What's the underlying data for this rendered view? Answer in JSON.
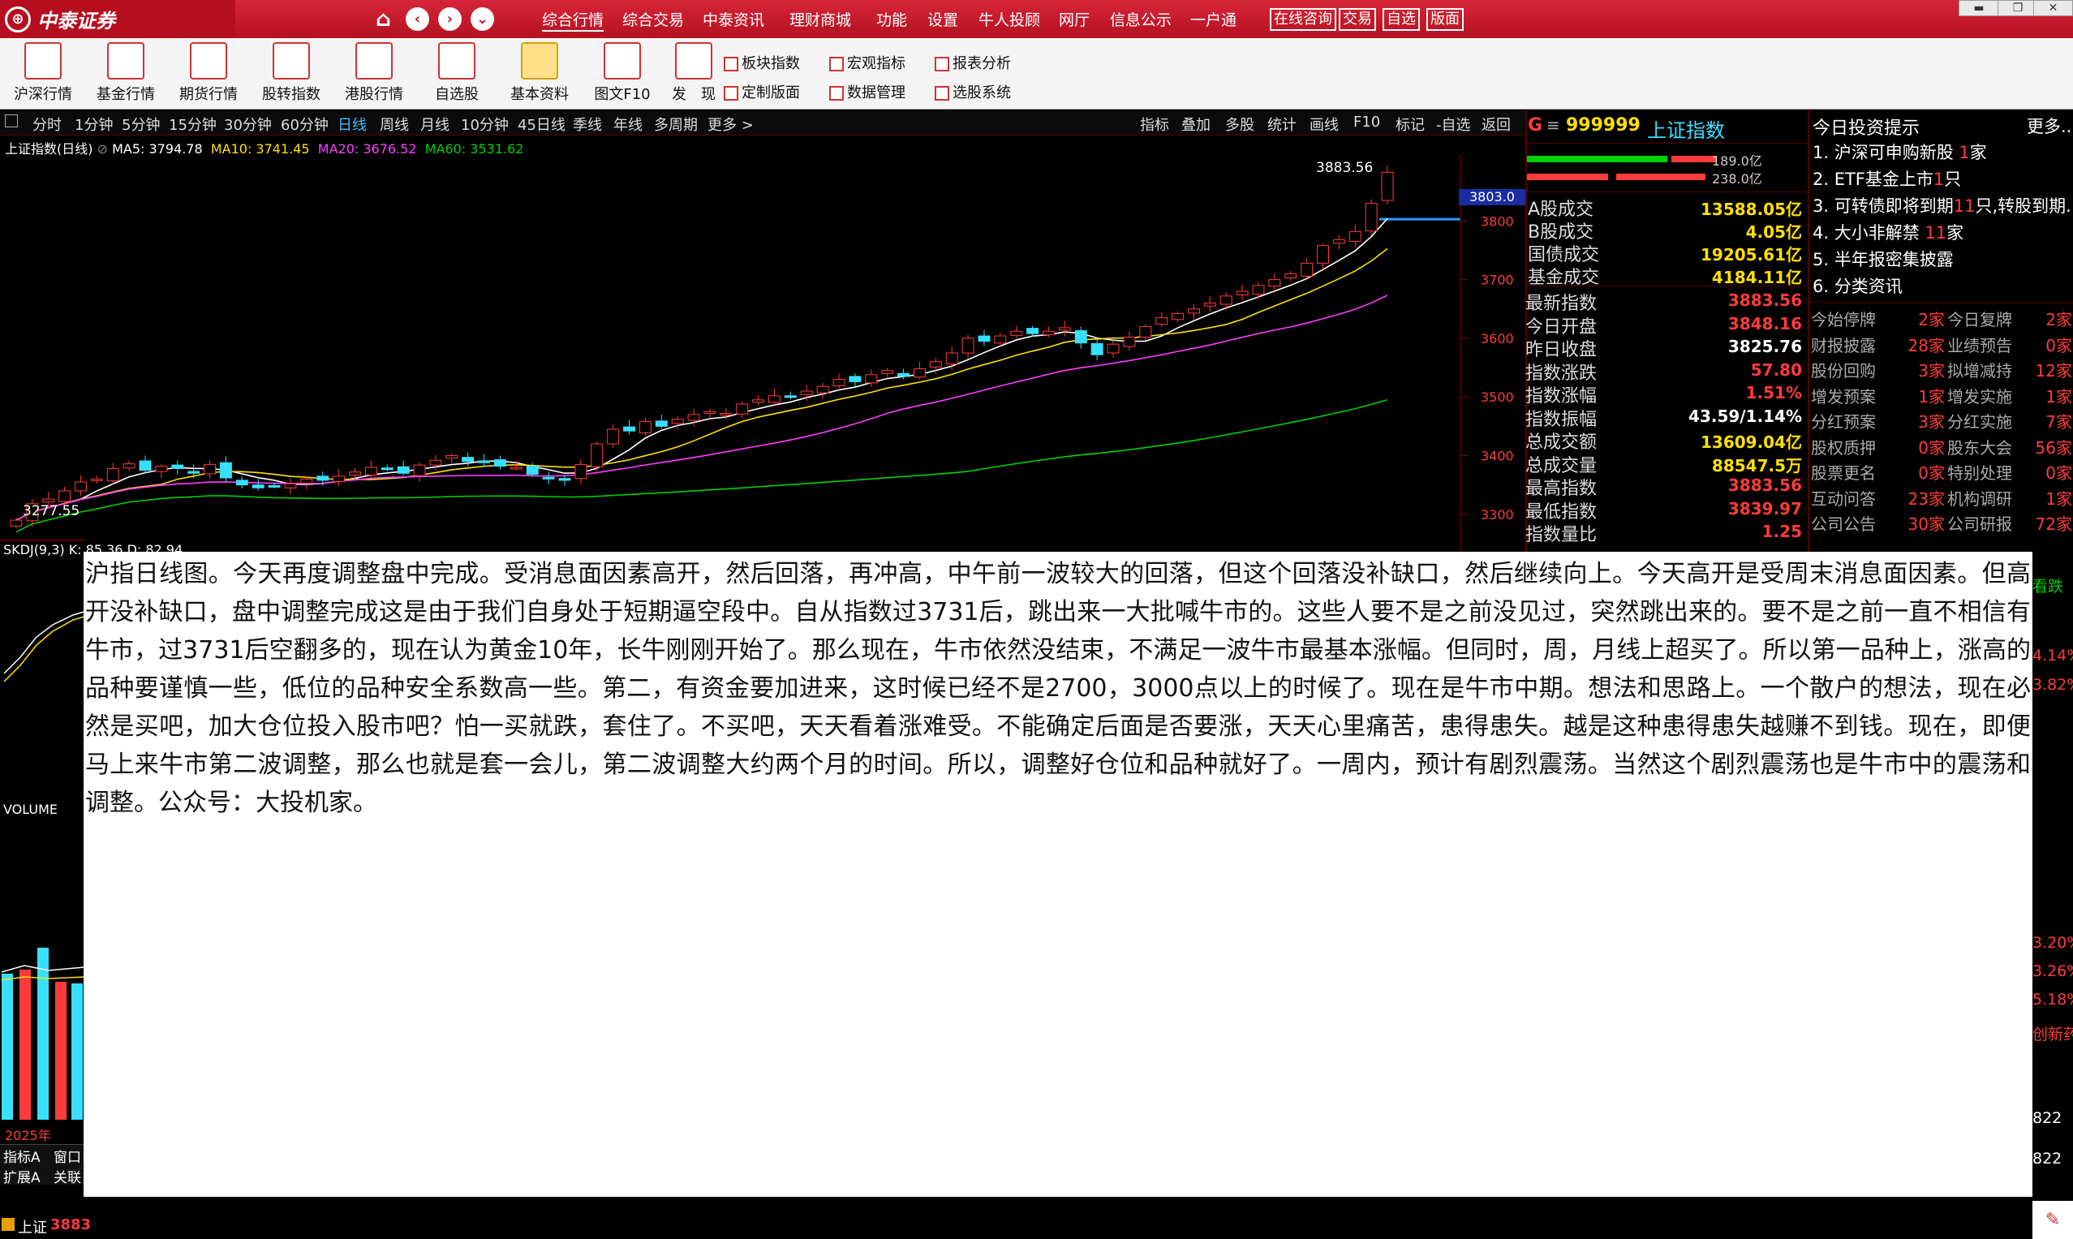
{
  "app": {
    "brand": "中泰证券",
    "logo_glyph": "⊕"
  },
  "top_menu": [
    "综合行情",
    "综合交易",
    "中泰资讯",
    "理财商城",
    "功能",
    "设置",
    "牛人投顾",
    "网厅",
    "信息公示",
    "一户通"
  ],
  "top_box_buttons": [
    "在线咨询",
    "交易",
    "自选",
    "版面"
  ],
  "window_controls": [
    "▬",
    "❐",
    "✕"
  ],
  "toolbar": {
    "big": [
      "沪深行情",
      "基金行情",
      "期货行情",
      "股转指数",
      "港股行情",
      "自选股",
      "基本资料",
      "图文F10",
      "发　现"
    ],
    "small": [
      [
        "板块指数",
        "宏观指标",
        "报表分析"
      ],
      [
        "定制版面",
        "数据管理",
        "选股系统"
      ]
    ]
  },
  "period_tabs": [
    "分时",
    "1分钟",
    "5分钟",
    "15分钟",
    "30分钟",
    "60分钟",
    "日线",
    "周线",
    "月线",
    "10分钟",
    "45日线",
    "季线",
    "年线",
    "多周期",
    "更多 >"
  ],
  "active_period": "日线",
  "chart_tools": [
    "指标",
    "叠加",
    "多股",
    "统计",
    "画线",
    "F10",
    "标记",
    "-自选",
    "返回"
  ],
  "chart_header": {
    "name": "上证指数(日线)",
    "ma5": "MA5: 3794.78",
    "ma10": "MA10: 3741.45",
    "ma20": "MA20: 3676.52",
    "ma60": "MA60: 3531.62"
  },
  "chart_labels": {
    "high": "3883.56",
    "low": "3277.55",
    "current_price_tag": "3803.0",
    "kdj": "SKDJ(9,3)  K: 85.36  D: 82.94",
    "volume": "VOLUME",
    "year": "2025年",
    "bottom_tabs": [
      "指标A",
      "窗口",
      "扩展A",
      "关联"
    ],
    "status_index": "上证",
    "status_value": "3883"
  },
  "colors": {
    "ma5": "#ffffff",
    "ma10": "#ffe000",
    "ma20": "#ff3cff",
    "ma60": "#00d000",
    "up": "#ff3b3b",
    "down": "#38e0ff"
  },
  "chart_data": {
    "type": "candlestick",
    "ylim": [
      3250,
      3900
    ],
    "yticks": [
      3300,
      3400,
      3500,
      3600,
      3700,
      3800
    ],
    "close": [
      3290,
      3318,
      3326,
      3340,
      3355,
      3360,
      3378,
      3386,
      3375,
      3382,
      3378,
      3370,
      3385,
      3362,
      3350,
      3345,
      3348,
      3352,
      3360,
      3358,
      3365,
      3372,
      3380,
      3378,
      3370,
      3384,
      3392,
      3400,
      3390,
      3388,
      3382,
      3380,
      3368,
      3362,
      3358,
      3385,
      3420,
      3445,
      3442,
      3458,
      3450,
      3462,
      3470,
      3475,
      3472,
      3488,
      3495,
      3502,
      3500,
      3510,
      3518,
      3530,
      3526,
      3538,
      3545,
      3535,
      3548,
      3560,
      3575,
      3600,
      3595,
      3604,
      3612,
      3608,
      3612,
      3618,
      3592,
      3572,
      3590,
      3602,
      3620,
      3635,
      3642,
      3650,
      3660,
      3672,
      3680,
      3690,
      3700,
      3710,
      3728,
      3758,
      3768,
      3782,
      3830,
      3883
    ]
  },
  "right_header": {
    "code": "999999",
    "name": "上证指数",
    "g_mark": "G",
    "top_vals": [
      "189.0亿",
      "238.0亿"
    ]
  },
  "market_rows": [
    {
      "label": "A股成交",
      "value": "13588.05亿"
    },
    {
      "label": "B股成交",
      "value": "4.05亿"
    },
    {
      "label": "国债成交",
      "value": "19205.61亿"
    },
    {
      "label": "基金成交",
      "value": "4184.11亿"
    }
  ],
  "index_rows": [
    {
      "label": "最新指数",
      "value": "3883.56",
      "c": "red"
    },
    {
      "label": "今日开盘",
      "value": "3848.16",
      "c": "red"
    },
    {
      "label": "昨日收盘",
      "value": "3825.76",
      "c": "wht"
    },
    {
      "label": "指数涨跌",
      "value": "57.80",
      "c": "red"
    },
    {
      "label": "指数涨幅",
      "value": "1.51%",
      "c": "red"
    },
    {
      "label": "指数振幅",
      "value": "43.59/1.14%",
      "c": "wht"
    },
    {
      "label": "总成交额",
      "value": "13609.04亿",
      "c": "yel"
    },
    {
      "label": "总成交量",
      "value": "88547.5万",
      "c": "yel"
    },
    {
      "label": "最高指数",
      "value": "3883.56",
      "c": "red"
    },
    {
      "label": "最低指数",
      "value": "3839.97",
      "c": "red"
    },
    {
      "label": "指数量比",
      "value": "1.25",
      "c": "red"
    }
  ],
  "tips": {
    "title": "今日投资提示",
    "more": "更多..",
    "items": [
      {
        "text": "1. 沪深可申购新股 ",
        "hl": "1",
        "tail": "家"
      },
      {
        "text": "2. ETF基金上市",
        "hl": "1",
        "tail": "只"
      },
      {
        "text": "3. 可转债即将到期",
        "hl": "11",
        "tail": "只,转股到期.."
      },
      {
        "text": "4. 大小非解禁 ",
        "hl": "11",
        "tail": "家"
      },
      {
        "text": "5. 半年报密集披露",
        "hl": "",
        "tail": ""
      },
      {
        "text": "6. 分类资讯",
        "hl": "",
        "tail": ""
      }
    ],
    "grid": [
      [
        "今始停牌",
        "2家",
        "今日复牌",
        "2家"
      ],
      [
        "财报披露",
        "28家",
        "业绩预告",
        "0家"
      ],
      [
        "股份回购",
        "3家",
        "拟增减持",
        "12家"
      ],
      [
        "增发预案",
        "1家",
        "增发实施",
        "1家"
      ],
      [
        "分红预案",
        "3家",
        "分红实施",
        "7家"
      ],
      [
        "股权质押",
        "0家",
        "股东大会",
        "56家"
      ],
      [
        "股票更名",
        "0家",
        "特别处理",
        "0家"
      ],
      [
        "互动问答",
        "23家",
        "机构调研",
        "1家"
      ],
      [
        "公司公告",
        "30家",
        "公司研报",
        "72家"
      ]
    ],
    "side_values": [
      "看跌",
      "4.14%",
      "3.82%",
      "3.20%",
      "3.26%",
      "5.18%",
      "创新药",
      "822",
      "822"
    ]
  },
  "overlay_text": "沪指日线图。今天再度调整盘中完成。受消息面因素高开，然后回落，再冲高，中午前一波较大的回落，但这个回落没补缺口，然后继续向上。今天高开是受周末消息面因素。但高开没补缺口，盘中调整完成这是由于我们自身处于短期逼空段中。自从指数过3731后，跳出来一大批喊牛市的。这些人要不是之前没见过，突然跳出来的。要不是之前一直不相信有牛市，过3731后空翻多的，现在认为黄金10年，长牛刚刚开始了。那么现在，牛市依然没结束，不满足一波牛市最基本涨幅。但同时，周，月线上超买了。所以第一品种上，涨高的品种要谨慎一些，低位的品种安全系数高一些。第二，有资金要加进来，这时候已经不是2700，3000点以上的时候了。现在是牛市中期。想法和思路上。一个散户的想法，现在必然是买吧，加大仓位投入股市吧？怕一买就跌，套住了。不买吧，天天看着涨难受。不能确定后面是否要涨，天天心里痛苦，患得患失。越是这种患得患失越赚不到钱。现在，即便马上来牛市第二波调整，那么也就是套一会儿，第二波调整大约两个月的时间。所以，调整好仓位和品种就好了。一周内，预计有剧烈震荡。当然这个剧烈震荡也是牛市中的震荡和调整。公众号：大投机家。"
}
